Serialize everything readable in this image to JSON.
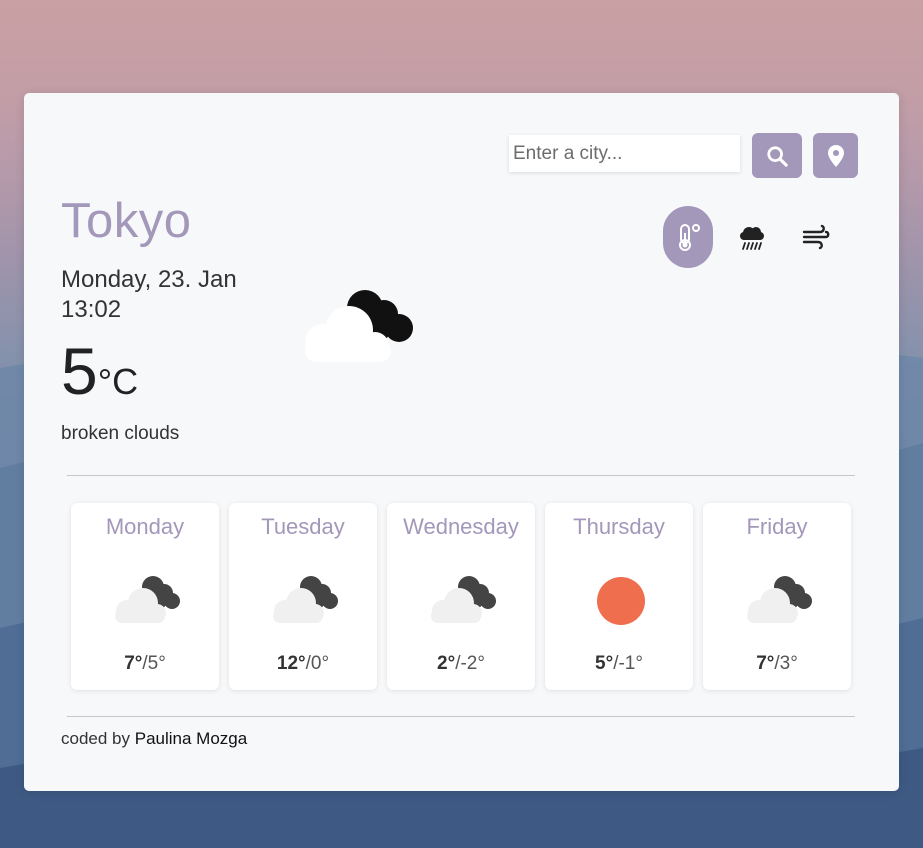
{
  "search": {
    "placeholder": "Enter a city...",
    "search_icon": "search-icon",
    "location_icon": "map-pin-icon"
  },
  "current": {
    "city": "Tokyo",
    "date": "Monday, 23. Jan",
    "time": "13:02",
    "temperature": "5",
    "unit": "°C",
    "description": "broken clouds",
    "icon": "broken-clouds-icon"
  },
  "modes": [
    {
      "icon": "thermometer-icon",
      "active": true
    },
    {
      "icon": "rain-cloud-icon",
      "active": false
    },
    {
      "icon": "wind-icon",
      "active": false
    }
  ],
  "forecast": [
    {
      "day": "Monday",
      "high": "7°",
      "low": "/5°",
      "icon": "broken-clouds-icon"
    },
    {
      "day": "Tuesday",
      "high": "12°",
      "low": "/0°",
      "icon": "broken-clouds-icon"
    },
    {
      "day": "Wednesday",
      "high": "2°",
      "low": "/-2°",
      "icon": "broken-clouds-icon"
    },
    {
      "day": "Thursday",
      "high": "5°",
      "low": "/-1°",
      "icon": "sun-icon"
    },
    {
      "day": "Friday",
      "high": "7°",
      "low": "/3°",
      "icon": "broken-clouds-icon"
    }
  ],
  "footer": {
    "prefix": "coded by",
    "author": "Paulina Mozga"
  },
  "colors": {
    "accent": "#a397ba",
    "sun": "#ee6e4e",
    "card_bg": "#f7f8fa"
  }
}
